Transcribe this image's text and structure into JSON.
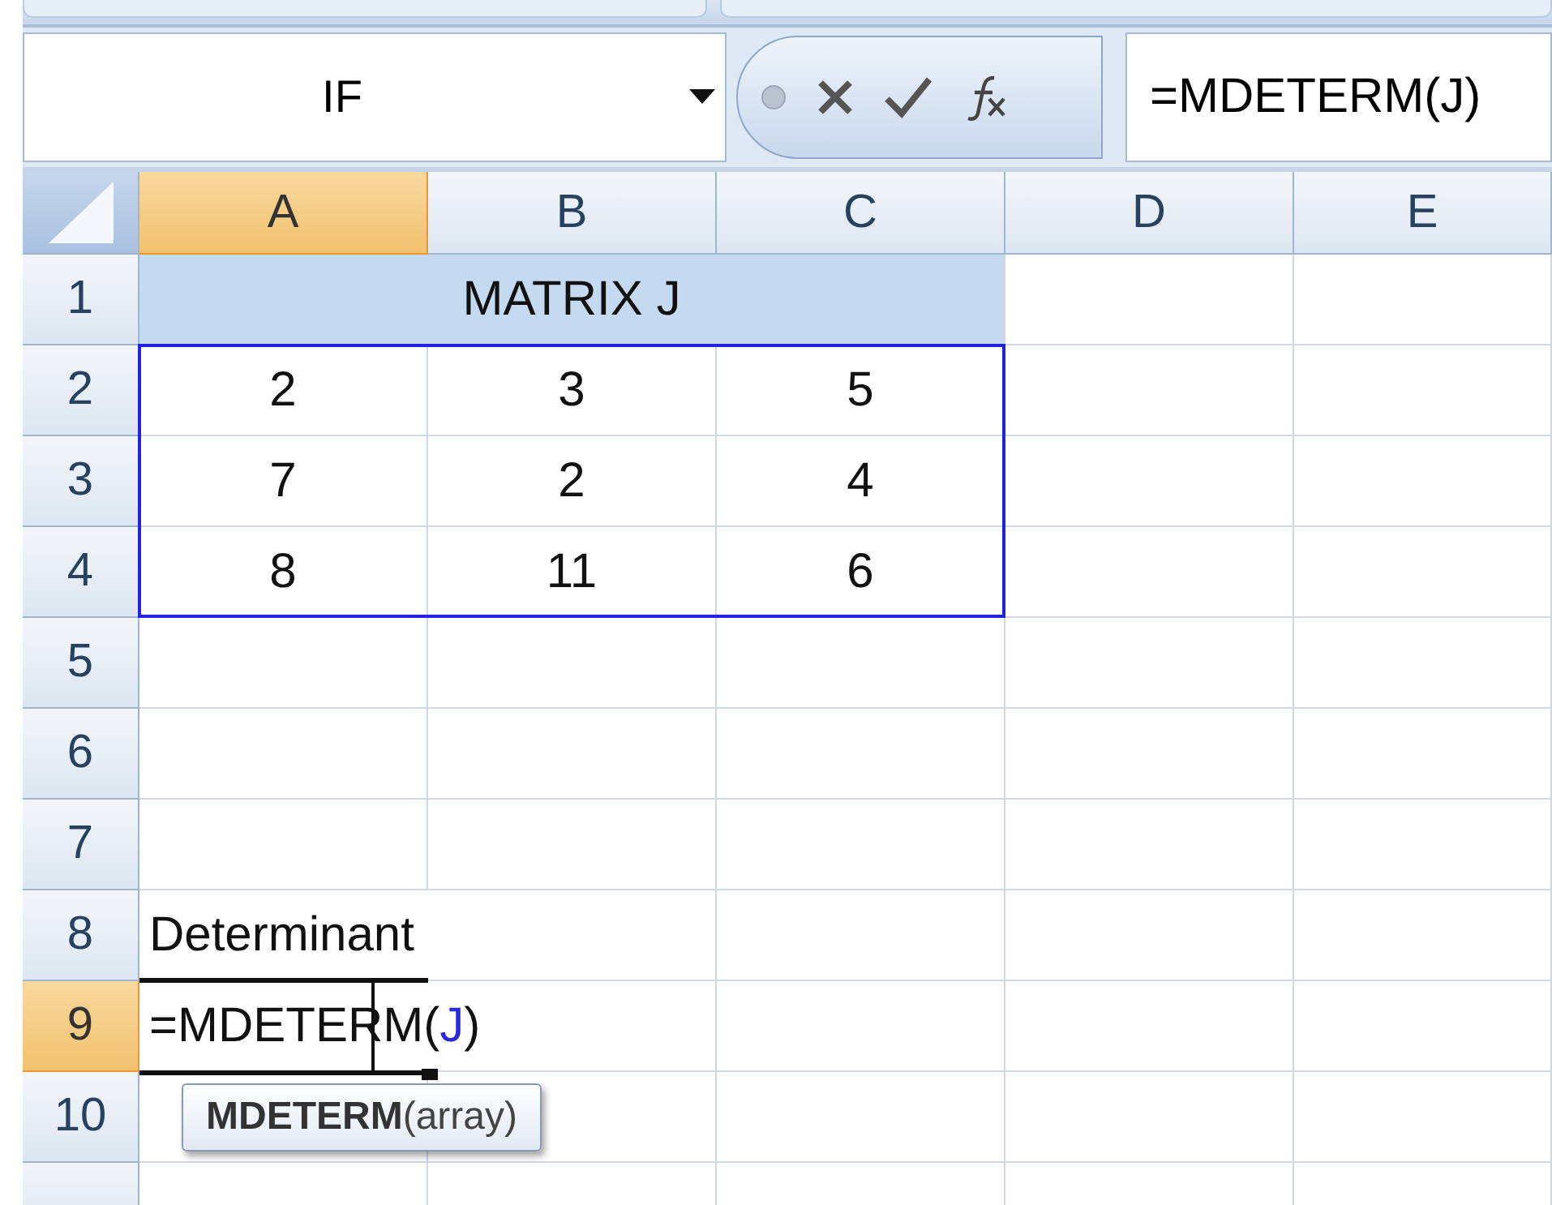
{
  "name_box": {
    "value": "IF"
  },
  "formula_bar": {
    "value": "=MDETERM(J)"
  },
  "columns": [
    {
      "label": "A",
      "selected": true
    },
    {
      "label": "B",
      "selected": false
    },
    {
      "label": "C",
      "selected": false
    },
    {
      "label": "D",
      "selected": false
    },
    {
      "label": "E",
      "selected": false
    }
  ],
  "rows": [
    {
      "label": "1",
      "selected": false,
      "kind": "title",
      "text": "MATRIX J"
    },
    {
      "label": "2",
      "selected": false,
      "kind": "matrix",
      "values": [
        "2",
        "3",
        "5"
      ]
    },
    {
      "label": "3",
      "selected": false,
      "kind": "matrix",
      "values": [
        "7",
        "2",
        "4"
      ]
    },
    {
      "label": "4",
      "selected": false,
      "kind": "matrix",
      "values": [
        "8",
        "11",
        "6"
      ]
    },
    {
      "label": "5",
      "selected": false,
      "kind": "empty"
    },
    {
      "label": "6",
      "selected": false,
      "kind": "empty"
    },
    {
      "label": "7",
      "selected": false,
      "kind": "empty"
    },
    {
      "label": "8",
      "selected": false,
      "kind": "text",
      "text": "Determinant"
    },
    {
      "label": "9",
      "selected": true,
      "kind": "editing",
      "parts": [
        {
          "text": "=MDETERM(",
          "kind": "plain"
        },
        {
          "text": "J",
          "kind": "reference"
        },
        {
          "text": ")",
          "kind": "plain"
        }
      ]
    },
    {
      "label": "10",
      "selected": false,
      "kind": "empty"
    }
  ],
  "tooltip": "**MDETERM**(array)"
}
